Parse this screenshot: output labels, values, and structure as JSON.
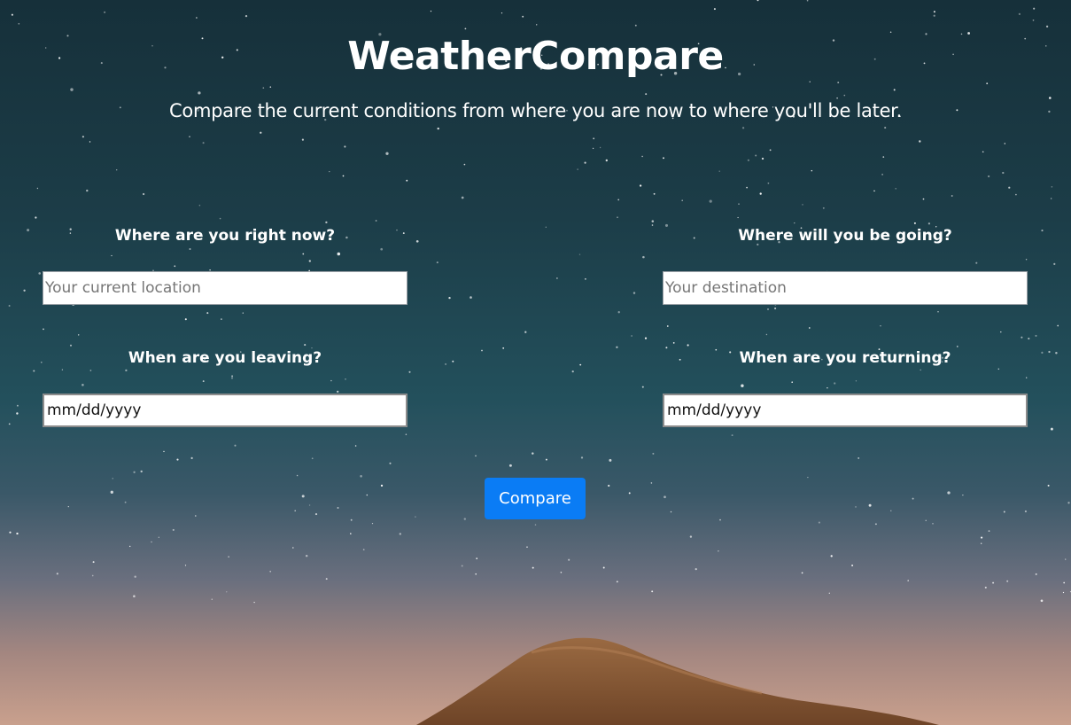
{
  "header": {
    "title": "WeatherCompare",
    "subtitle": "Compare the current conditions from where you are now to where you'll be later."
  },
  "form": {
    "origin": {
      "label": "Where are you right now?",
      "placeholder": "Your current location",
      "value": ""
    },
    "destination": {
      "label": "Where will you be going?",
      "placeholder": "Your destination",
      "value": ""
    },
    "departure": {
      "label": "When are you leaving?",
      "display": "mm/dd/yyyy"
    },
    "return": {
      "label": "When are you returning?",
      "display": "mm/dd/yyyy"
    },
    "submit_label": "Compare"
  },
  "colors": {
    "button": "#0a7cf5",
    "sky_top": "#16303a",
    "sky_bottom": "#c9a08d",
    "mountain": "#8a5a35"
  }
}
